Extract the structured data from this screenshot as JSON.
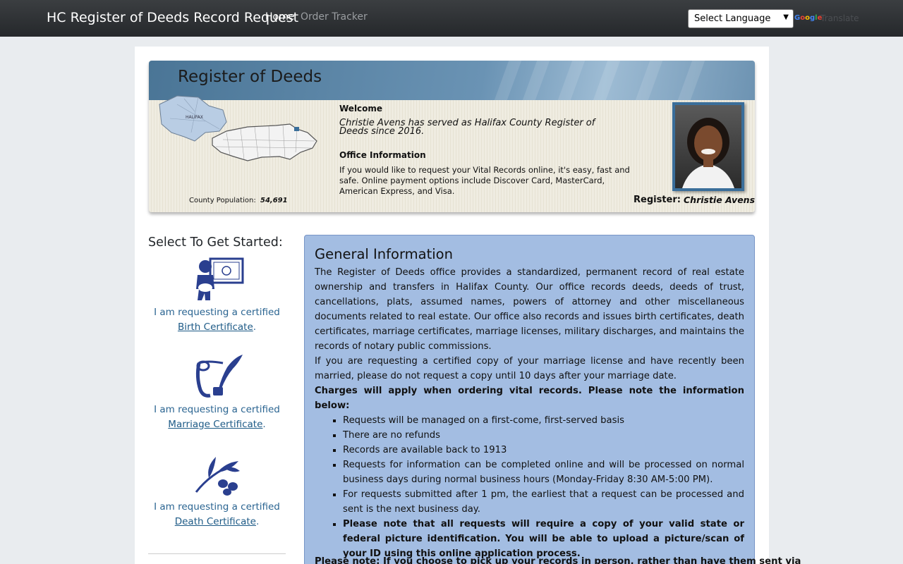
{
  "navbar": {
    "brand": "HC Register of Deeds Record Request",
    "links": [
      {
        "label": "Home",
        "active": true
      },
      {
        "label": "Order Tracker",
        "active": false
      }
    ],
    "language_select": "Select Language",
    "google_logo": "Google",
    "translate_label": "Translate"
  },
  "banner": {
    "title": "Register of Deeds",
    "welcome_heading": "Welcome",
    "welcome_text": "Christie Avens has served as Halifax County Register of Deeds since 2016.",
    "office_heading": "Office Information",
    "office_text": "If you would like to request your Vital Records online, it's easy, fast and safe.  Online payment options include Discover Card, MasterCard, American Express, and Visa.",
    "population_label": "County Population:",
    "population_value": "54,691",
    "register_label": "Register:",
    "register_name": "Christie Avens",
    "map_labels": [
      "HALIFAX"
    ]
  },
  "sidebar": {
    "heading": "Select To Get Started:",
    "items": [
      {
        "prefix": "I am requesting a certified ",
        "link": "Birth Certificate",
        "suffix": ".",
        "icon": "baby-certificate-icon"
      },
      {
        "prefix": "I am requesting a certified ",
        "link": "Marriage Certificate",
        "suffix": ".",
        "icon": "scroll-quill-icon"
      },
      {
        "prefix": "I am requesting a certified ",
        "link": "Death Certificate",
        "suffix": ".",
        "icon": "olive-branch-icon"
      }
    ]
  },
  "general": {
    "title": "General Information",
    "para1": "The Register of Deeds office provides a standardized, permanent record of real estate ownership and transfers in Halifax County. Our office records deeds, deeds of trust, cancellations, plats, assumed names, powers of attorney and other miscellaneous documents related to real estate. Our office also records and issues birth certificates, death certificates, marriage certificates, marriage licenses, military discharges, and maintains the records of notary public commissions.",
    "para2": "If you are requesting a certified copy of your marriage license and have recently been married, please do not request a copy until 10 days after your marriage date.",
    "charges": "Charges will apply when ordering vital records. Please note the information below:",
    "bullets": [
      "Requests will be managed on a first-come, first-served basis",
      "There are no refunds",
      "Records are available back to 1913",
      "Requests for information can be completed online and will be processed on normal business days during normal business hours (Monday-Friday 8:30 AM-5:00 PM).",
      "For requests submitted after 1 pm, the earliest that a request can be processed and sent is the next business day."
    ],
    "bullet_bold": "Please note that all requests will require a copy of your valid state or federal picture identification. You will be able to upload a picture/scan of your ID using this online application process.",
    "note": "Please note: If you choose to pick up your records in person, rather than have them sent via"
  },
  "colors": {
    "navbar": "#2b2e31",
    "info_box": "#a3bde2",
    "link": "#1d5a86",
    "icon_blue": "#2a3f8f"
  }
}
